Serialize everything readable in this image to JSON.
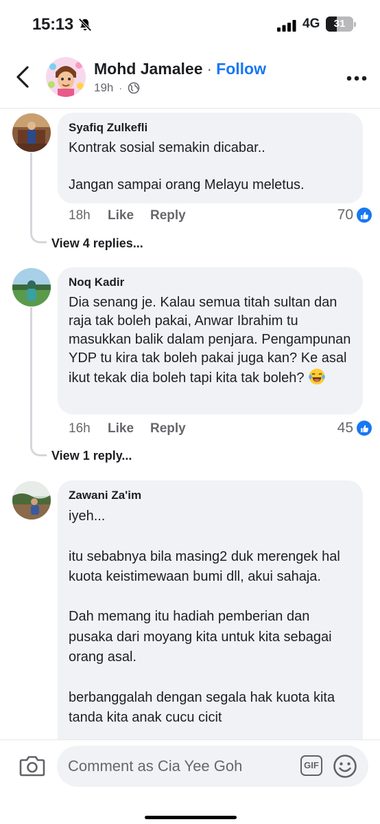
{
  "status": {
    "time": "15:13",
    "network": "4G",
    "battery": "31",
    "battery_level_percent": 31
  },
  "post_header": {
    "author": "Mohd Jamalee",
    "separator": "·",
    "follow_label": "Follow",
    "age": "19h",
    "meta_separator": "·"
  },
  "comments": [
    {
      "author": "Syafiq Zulkefli",
      "text": "Kontrak sosial semakin dicabar..\n\nJangan sampai orang Melayu meletus.",
      "age": "18h",
      "like_label": "Like",
      "reply_label": "Reply",
      "reaction_count": "70",
      "view_replies": "View 4 replies..."
    },
    {
      "author": "Noq Kadir",
      "text": "Dia senang je. Kalau semua titah sultan dan raja tak boleh pakai, Anwar Ibrahim tu masukkan balik dalam penjara. Pengampunan YDP tu kira tak boleh pakai juga kan? Ke asal ikut tekak dia boleh tapi kita tak boleh?",
      "emoji": "laughing-tears",
      "age": "16h",
      "like_label": "Like",
      "reply_label": "Reply",
      "reaction_count": "45",
      "view_replies": "View 1 reply..."
    },
    {
      "author": "Zawani Za'im",
      "text": "iyeh...\n\nitu sebabnya bila masing2 duk merengek hal kuota keistimewaan bumi dll, akui sahaja.\n\nDah memang itu hadiah pemberian dan pusaka dari moyang kita untuk kita sebagai orang asal.\n\nberbanggalah dengan segala hak kuota kita tanda kita anak cucu cicit"
    }
  ],
  "composer": {
    "placeholder": "Comment as Cia Yee Goh",
    "gif_label": "GIF"
  },
  "colors": {
    "accent": "#1877f2",
    "bubble": "#f0f2f5",
    "secondary_text": "#65676b"
  }
}
